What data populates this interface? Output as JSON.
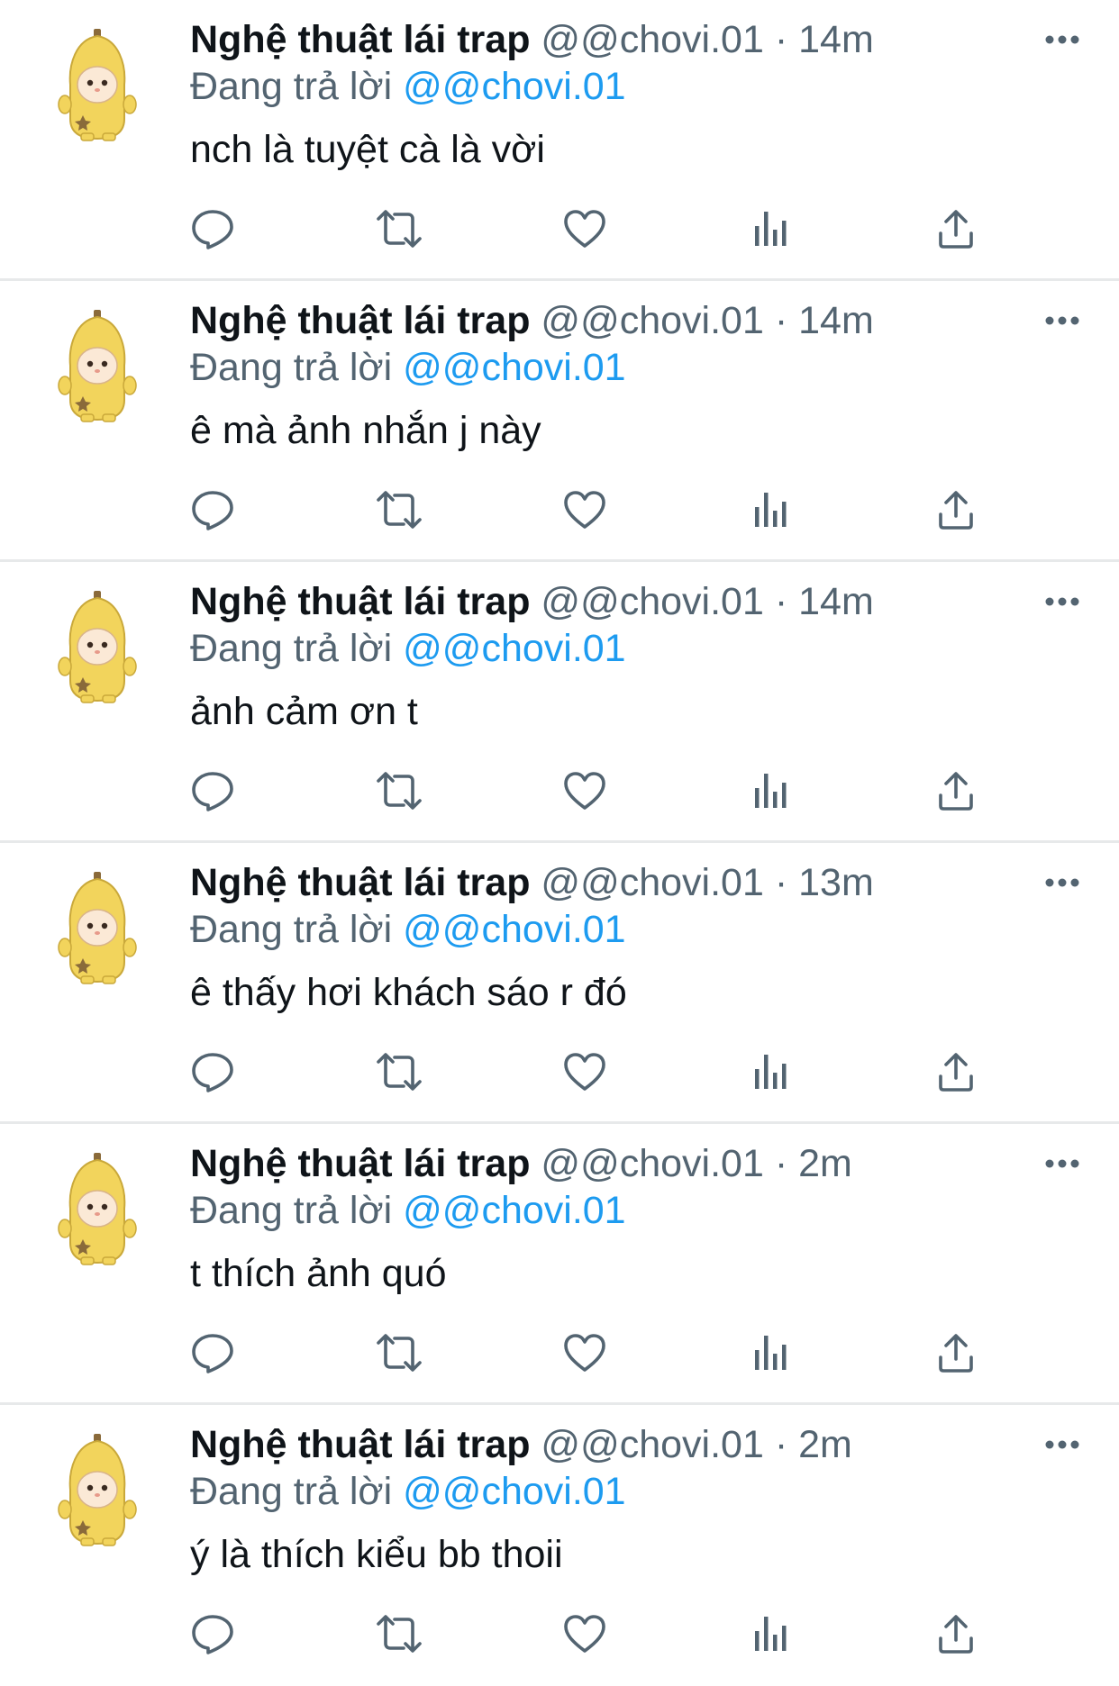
{
  "icon_color": "#536471",
  "accent_color": "#1d9bf0",
  "tweets": [
    {
      "name": "Nghệ thuật lái trap",
      "handle": "@@chovi.01",
      "dot": "·",
      "time": "14m",
      "reply_prefix": "Đang trả lời",
      "reply_to": "@@chovi.01",
      "text": "nch là tuyệt cà là vời"
    },
    {
      "name": "Nghệ thuật lái trap",
      "handle": "@@chovi.01",
      "dot": "·",
      "time": "14m",
      "reply_prefix": "Đang trả lời",
      "reply_to": "@@chovi.01",
      "text": "ê mà ảnh nhắn j này"
    },
    {
      "name": "Nghệ thuật lái trap",
      "handle": "@@chovi.01",
      "dot": "·",
      "time": "14m",
      "reply_prefix": "Đang trả lời",
      "reply_to": "@@chovi.01",
      "text": "ảnh cảm ơn t"
    },
    {
      "name": "Nghệ thuật lái trap",
      "handle": "@@chovi.01",
      "dot": "·",
      "time": "13m",
      "reply_prefix": "Đang trả lời",
      "reply_to": "@@chovi.01",
      "text": "ê thấy hơi khách sáo r đó"
    },
    {
      "name": "Nghệ thuật lái trap",
      "handle": "@@chovi.01",
      "dot": "·",
      "time": "2m",
      "reply_prefix": "Đang trả lời",
      "reply_to": "@@chovi.01",
      "text": "t thích ảnh quó"
    },
    {
      "name": "Nghệ thuật lái trap",
      "handle": "@@chovi.01",
      "dot": "·",
      "time": "2m",
      "reply_prefix": "Đang trả lời",
      "reply_to": "@@chovi.01",
      "text": "ý là thích kiểu bb thoii"
    }
  ],
  "icons": {
    "avatar": "banana-cat-avatar",
    "more": "more-horizontal-icon",
    "reply": "reply-icon",
    "retweet": "retweet-icon",
    "like": "heart-icon",
    "views": "views-chart-icon",
    "share": "share-icon"
  }
}
